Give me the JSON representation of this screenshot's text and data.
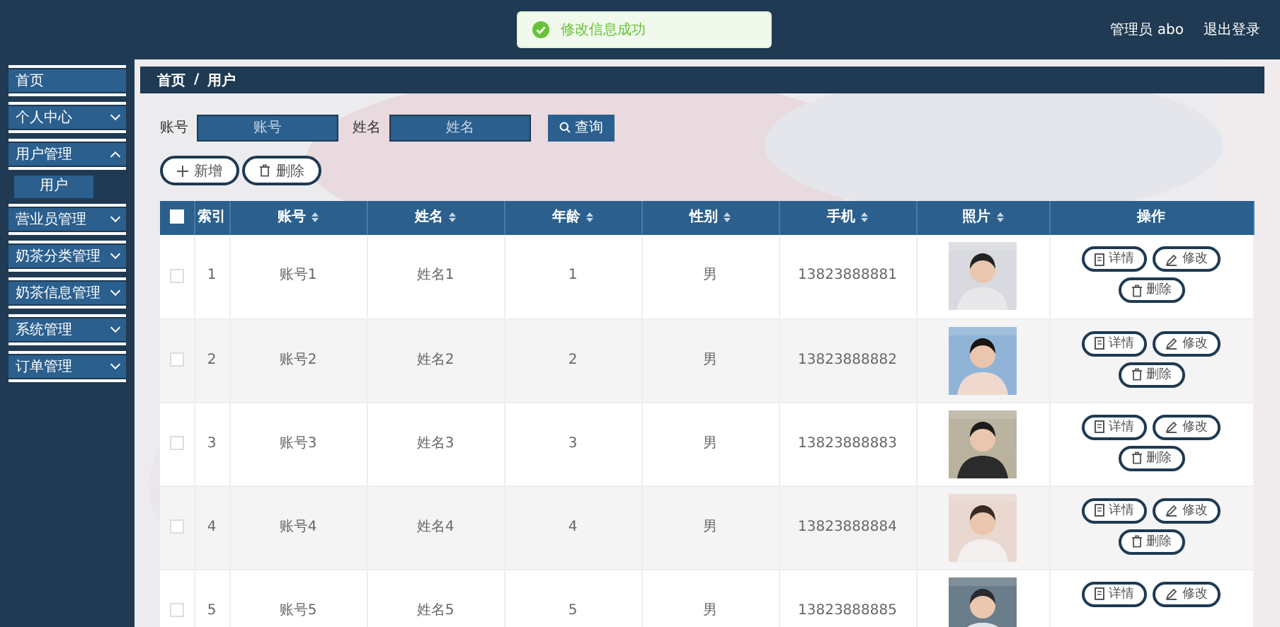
{
  "header": {
    "toast": {
      "kind": "success",
      "message": "修改信息成功"
    },
    "user": "管理员 abo",
    "logout": "退出登录"
  },
  "sidebar": {
    "items": [
      {
        "label": "首页",
        "kind": "link"
      },
      {
        "label": "个人中心",
        "kind": "menu",
        "expanded": false
      },
      {
        "label": "用户管理",
        "kind": "menu",
        "expanded": true,
        "children": [
          {
            "label": "用户",
            "selected": true
          }
        ]
      },
      {
        "label": "营业员管理",
        "kind": "menu",
        "expanded": false
      },
      {
        "label": "奶茶分类管理",
        "kind": "menu",
        "expanded": false
      },
      {
        "label": "奶茶信息管理",
        "kind": "menu",
        "expanded": false
      },
      {
        "label": "系统管理",
        "kind": "menu",
        "expanded": false
      },
      {
        "label": "订单管理",
        "kind": "menu",
        "expanded": false
      }
    ]
  },
  "breadcrumb": {
    "items": [
      "首页",
      "用户"
    ],
    "separator": "/"
  },
  "search": {
    "fields": [
      {
        "label": "账号",
        "placeholder": "账号"
      },
      {
        "label": "姓名",
        "placeholder": "姓名"
      }
    ],
    "button": "查询"
  },
  "actions": [
    {
      "kind": "add",
      "label": "新增"
    },
    {
      "kind": "delete",
      "label": "删除"
    }
  ],
  "table": {
    "select_all": {
      "checked": false
    },
    "columns": [
      {
        "label": "索引",
        "sortable": false
      },
      {
        "label": "账号",
        "sortable": true
      },
      {
        "label": "姓名",
        "sortable": true
      },
      {
        "label": "年龄",
        "sortable": true
      },
      {
        "label": "性别",
        "sortable": true
      },
      {
        "label": "手机",
        "sortable": true
      },
      {
        "label": "照片",
        "sortable": true
      },
      {
        "label": "操作",
        "sortable": false
      }
    ],
    "rows": [
      {
        "checked": false,
        "cells": [
          "1",
          "账号1",
          "姓名1",
          "1",
          "男",
          "13823888881"
        ],
        "photo": {
          "kind": "picture"
        },
        "actions": [
          {
            "kind": "detail",
            "label": "详情"
          },
          {
            "kind": "edit",
            "label": "修改"
          },
          {
            "kind": "delete",
            "label": "删除"
          }
        ]
      },
      {
        "checked": false,
        "cells": [
          "2",
          "账号2",
          "姓名2",
          "2",
          "男",
          "13823888882"
        ],
        "photo": {
          "kind": "picture"
        },
        "actions": [
          {
            "kind": "detail",
            "label": "详情"
          },
          {
            "kind": "edit",
            "label": "修改"
          },
          {
            "kind": "delete",
            "label": "删除"
          }
        ]
      },
      {
        "checked": false,
        "cells": [
          "3",
          "账号3",
          "姓名3",
          "3",
          "男",
          "13823888883"
        ],
        "photo": {
          "kind": "picture"
        },
        "actions": [
          {
            "kind": "detail",
            "label": "详情"
          },
          {
            "kind": "edit",
            "label": "修改"
          },
          {
            "kind": "delete",
            "label": "删除"
          }
        ]
      },
      {
        "checked": false,
        "cells": [
          "4",
          "账号4",
          "姓名4",
          "4",
          "男",
          "13823888884"
        ],
        "photo": {
          "kind": "picture"
        },
        "actions": [
          {
            "kind": "detail",
            "label": "详情"
          },
          {
            "kind": "edit",
            "label": "修改"
          },
          {
            "kind": "delete",
            "label": "删除"
          }
        ]
      },
      {
        "checked": false,
        "cells": [
          "5",
          "账号5",
          "姓名5",
          "5",
          "男",
          "13823888885"
        ],
        "photo": {
          "kind": "picture"
        },
        "actions": [
          {
            "kind": "detail",
            "label": "详情"
          },
          {
            "kind": "edit",
            "label": "修改"
          }
        ]
      }
    ]
  }
}
